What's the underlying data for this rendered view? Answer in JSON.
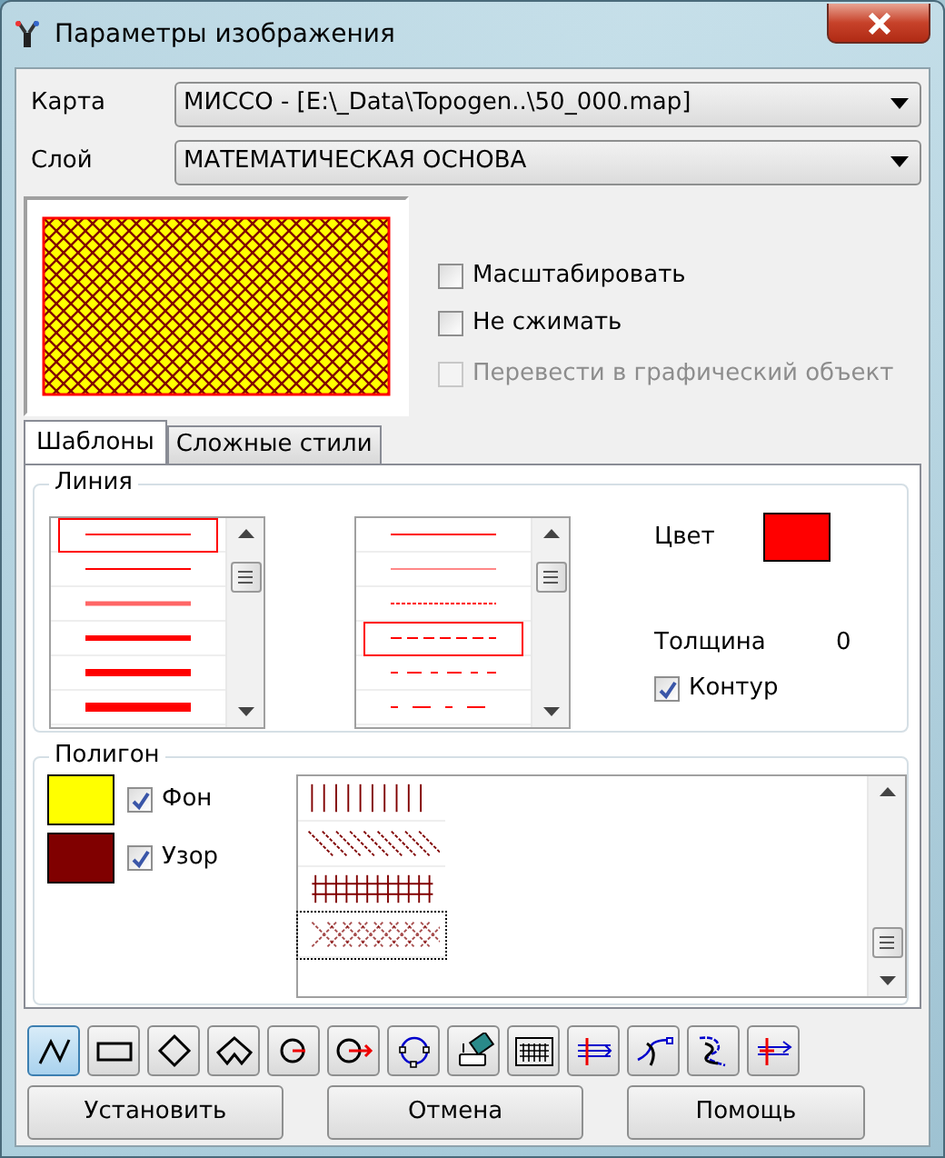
{
  "window": {
    "title": "Параметры изображения"
  },
  "map": {
    "label": "Карта",
    "value": "МИССО - [E:\\_Data\\Topogen..\\50_000.map]"
  },
  "layer": {
    "label": "Слой",
    "value": "МАТЕМАТИЧЕСКАЯ ОСНОВА"
  },
  "options": [
    {
      "label": "Масштабировать",
      "checked": false,
      "disabled": false
    },
    {
      "label": "Не сжимать",
      "checked": false,
      "disabled": false
    },
    {
      "label": "Перевести в графический объект",
      "checked": false,
      "disabled": true
    }
  ],
  "tabs": [
    {
      "label": "Шаблоны",
      "selected": true
    },
    {
      "label": "Сложные стили",
      "selected": false
    }
  ],
  "line": {
    "title": "Линия",
    "widths": [
      {
        "kind": "hairline",
        "selected": true
      },
      {
        "kind": "thin",
        "selected": false
      },
      {
        "kind": "double",
        "selected": false
      },
      {
        "kind": "medium",
        "selected": false
      },
      {
        "kind": "thick",
        "selected": false
      },
      {
        "kind": "heavy",
        "selected": false
      }
    ],
    "styles": [
      {
        "kind": "solid",
        "selected": false
      },
      {
        "kind": "faint",
        "selected": false
      },
      {
        "kind": "dotted",
        "selected": false
      },
      {
        "kind": "dashed",
        "selected": true
      },
      {
        "kind": "dashdot",
        "selected": false
      },
      {
        "kind": "longdash",
        "selected": false
      }
    ],
    "color_label": "Цвет",
    "color": "#ff0000",
    "thickness_label": "Толщина",
    "thickness": "0",
    "contour": {
      "label": "Контур",
      "checked": true
    }
  },
  "polygon": {
    "title": "Полигон",
    "fill": {
      "label": "Фон",
      "color": "#ffff00",
      "checked": true
    },
    "pattern": {
      "label": "Узор",
      "color": "#800000",
      "checked": true
    },
    "patterns": [
      {
        "kind": "vertical",
        "selected": false
      },
      {
        "kind": "diagonal",
        "selected": false
      },
      {
        "kind": "grid",
        "selected": false
      },
      {
        "kind": "crosshatch",
        "selected": true
      }
    ]
  },
  "tools": [
    {
      "kind": "polyline",
      "selected": true
    },
    {
      "kind": "rectangle",
      "selected": false
    },
    {
      "kind": "diamond",
      "selected": false
    },
    {
      "kind": "polygon",
      "selected": false
    },
    {
      "kind": "circle",
      "selected": false
    },
    {
      "kind": "circlearrow",
      "selected": false
    },
    {
      "kind": "circlepoints",
      "selected": false
    },
    {
      "kind": "device",
      "selected": false
    },
    {
      "kind": "keyboard",
      "selected": false
    },
    {
      "kind": "parallel",
      "selected": false
    },
    {
      "kind": "curve",
      "selected": false
    },
    {
      "kind": "spline",
      "selected": false
    },
    {
      "kind": "linesarrow",
      "selected": false
    }
  ],
  "buttons": [
    "Установить",
    "Отмена",
    "Помощь"
  ]
}
